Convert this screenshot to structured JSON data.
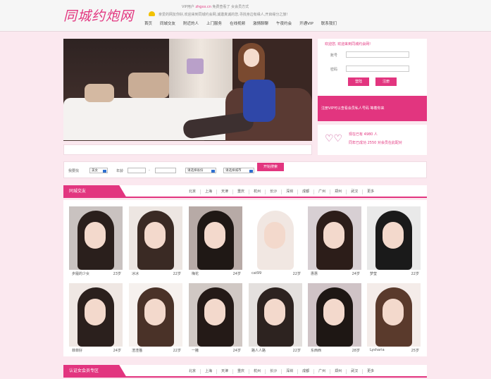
{
  "header": {
    "logo": "同城约炮网",
    "notice_top_prefix": "VIP用户",
    "notice_top_name": "zhgxx.cn",
    "notice_top_suffix": "免费查看了 女会员方式",
    "notice_sub": "亲爱的网友你好,欢迎来到同城约会网,诚邀真诚的您,寻找身边有缘人,开启缘分之旅!",
    "nav": [
      "首页",
      "同城交友",
      "附近的人",
      "上门服务",
      "在线视频",
      "激情聊聊",
      "午夜约会",
      "开通VIP",
      "联系我们"
    ]
  },
  "banner": {
    "slides": 2,
    "active_slide": 1
  },
  "login": {
    "welcome": "欢迎您, 欢迎来到同城约会网!",
    "username_label": "账号",
    "password_label": "密码",
    "login_button": "登陆",
    "register_button": "注册",
    "promo": "注册VIP可以查看会员私人号码 等着你来"
  },
  "vip_box": {
    "line1": "现在已有 4980 人",
    "line2": "同年已成功 2550 对会员在此配对"
  },
  "search": {
    "gender_label": "我要找",
    "gender_value": "美女",
    "age_label": "年龄",
    "location1": "请选择省份",
    "location2": "请选择城市",
    "search_button": "开始搜索"
  },
  "section1": {
    "title": "同城交友",
    "cities": [
      "北京",
      "上海",
      "天津",
      "重庆",
      "杭州",
      "长沙",
      "深圳",
      "成都",
      "广州",
      "郑州",
      "武汉",
      "更多"
    ]
  },
  "section2": {
    "title": "认证女会员专区",
    "cities": [
      "北京",
      "上海",
      "天津",
      "重庆",
      "杭州",
      "长沙",
      "深圳",
      "成都",
      "广州",
      "郑州",
      "武汉",
      "更多"
    ]
  },
  "members": [
    {
      "name": "步履的少女",
      "age": "23岁"
    },
    {
      "name": "冰冰",
      "age": "22岁"
    },
    {
      "name": "梅花",
      "age": "24岁"
    },
    {
      "name": "cat99",
      "age": "22岁"
    },
    {
      "name": "惠惠",
      "age": "24岁"
    },
    {
      "name": "梦莹",
      "age": "22岁"
    },
    {
      "name": "菲菲好",
      "age": "24岁"
    },
    {
      "name": "渣渣猫",
      "age": "22岁"
    },
    {
      "name": "一撇",
      "age": "24岁"
    },
    {
      "name": "路人人路",
      "age": "22岁"
    },
    {
      "name": "东西西",
      "age": "28岁"
    },
    {
      "name": "Lysharia",
      "age": "25岁"
    }
  ],
  "colors": {
    "accent": "#e2357f",
    "background": "#fbe8ef"
  }
}
